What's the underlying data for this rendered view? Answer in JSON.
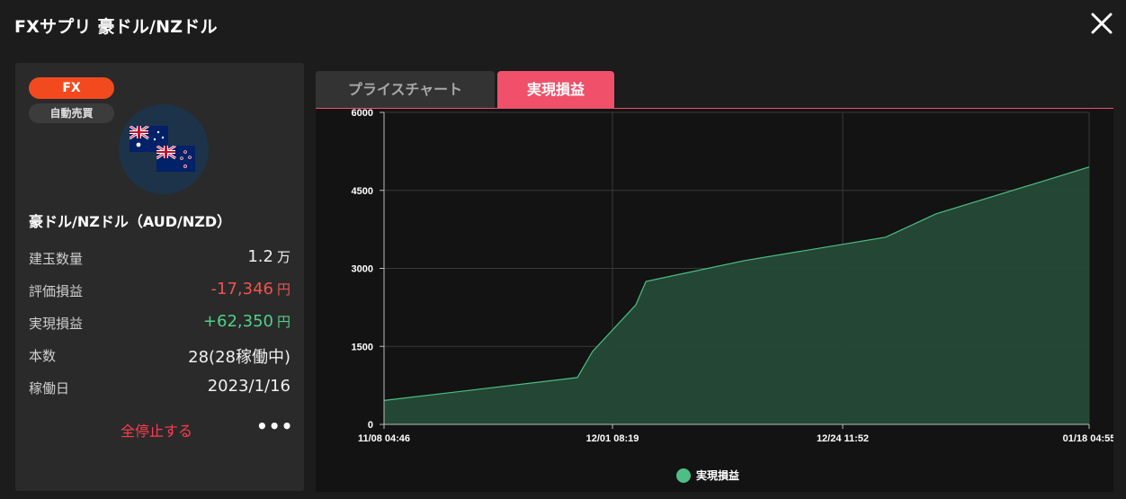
{
  "window": {
    "title": "FXサプリ 豪ドル/NZドル"
  },
  "panel": {
    "badge_fx": "FX",
    "badge_auto": "自動売買",
    "pair_name": "豪ドル/NZドル（AUD/NZD）",
    "rows": [
      {
        "label": "建玉数量",
        "value": "1.2",
        "unit": "万"
      },
      {
        "label": "評価損益",
        "value": "-17,346",
        "unit": "円"
      },
      {
        "label": "実現損益",
        "value": "+62,350",
        "unit": "円"
      },
      {
        "label": "本数",
        "value": "28(28稼働中)",
        "unit": ""
      },
      {
        "label": "稼働日",
        "value": "2023/1/16",
        "unit": ""
      }
    ],
    "stop_label": "全停止する",
    "more_label": "•••",
    "colors": {
      "negative": "#ef5350",
      "positive": "#4fd18b",
      "stop": "#ff3b4e"
    }
  },
  "tabs": [
    {
      "label": "プライスチャート",
      "active": false
    },
    {
      "label": "実現損益",
      "active": true
    }
  ],
  "chart_data": {
    "type": "area",
    "title": "",
    "xlabel": "",
    "ylabel": "",
    "x_tick_labels": [
      "11/08 04:46",
      "12/01 08:19",
      "12/24 11:52",
      "01/18 04:55"
    ],
    "y_ticks": [
      0,
      1500,
      3000,
      4500,
      6000
    ],
    "ylim": [
      0,
      6000
    ],
    "grid": true,
    "legend_position": "bottom-center",
    "series": [
      {
        "name": "実現損益",
        "color": "#4dbf84",
        "fill": "#244a36",
        "x": [
          "11/08 04:46",
          "11/27 10:00",
          "11/29 10:00",
          "12/03 00:00",
          "12/04 02:00",
          "12/14 00:00",
          "12/28 00:00",
          "01/02 00:00",
          "01/13 00:00",
          "01/18 04:55"
        ],
        "x_days": [
          0,
          19.2,
          20.7,
          25.0,
          26.0,
          35.8,
          49.8,
          54.8,
          65.8,
          70.0
        ],
        "values": [
          460,
          900,
          1400,
          2300,
          2750,
          3150,
          3600,
          4050,
          4700,
          4950
        ]
      }
    ]
  }
}
